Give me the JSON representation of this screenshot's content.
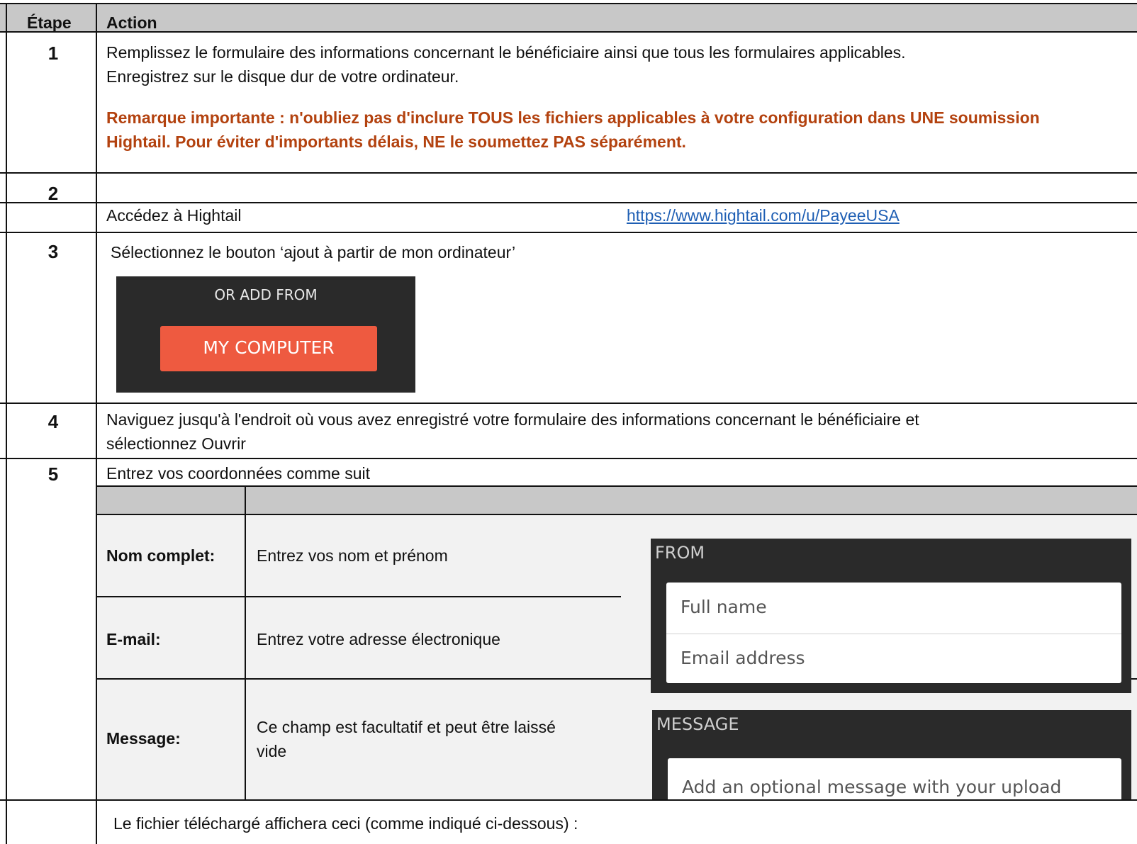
{
  "header": {
    "col_step": "Étape",
    "col_action": "Action"
  },
  "rows": [
    {
      "num": "1",
      "line1": "Remplissez le formulaire des informations concernant le bénéficiaire ainsi que tous les formulaires applicables.",
      "line2": "Enregistrez sur le disque dur de votre ordinateur.",
      "warn1": "Remarque importante : n'oubliez pas d'inclure TOUS les fichiers applicables à votre configuration dans UNE soumission",
      "warn2": "Hightail.  Pour éviter d'importants délais, NE le soumettez PAS séparément."
    },
    {
      "num": "2",
      "text": "Accédez à Hightail",
      "link": "https://www.hightail.com/u/PayeeUSA"
    },
    {
      "num": "3",
      "text": "Sélectionnez le bouton ‘ajout à partir de mon ordinateur’"
    },
    {
      "num": "4",
      "line1": "Naviguez jusqu'à l'endroit où vous avez enregistré votre formulaire des informations concernant le bénéficiaire et",
      "line2": "sélectionnez Ouvrir"
    },
    {
      "num": "5",
      "text": "Entrez vos coordonnées comme suit"
    },
    {
      "num": "",
      "text": "Le fichier téléchargé affichera ceci (comme indiqué ci-dessous) :"
    }
  ],
  "upload_widget": {
    "label": "OR ADD FROM",
    "button": "MY COMPUTER"
  },
  "fields_table": [
    {
      "label": "Nom complet:",
      "desc": "Entrez vos nom et prénom"
    },
    {
      "label": "E-mail:",
      "desc": "Entrez votre adresse électronique"
    },
    {
      "label": "Message:",
      "desc_line1": "Ce champ est facultatif et peut être laissé",
      "desc_line2": "vide"
    }
  ],
  "from_panel": {
    "title": "FROM",
    "name_placeholder": "Full name",
    "email_placeholder": "Email address"
  },
  "message_panel": {
    "title": "MESSAGE",
    "placeholder": "Add an optional message with your upload"
  },
  "colors": {
    "header_bg": "#c8c8c8",
    "warn": "#b3420f",
    "link": "#1f5fb4",
    "button": "#ee5a40",
    "panel": "#2a2a2a",
    "inner_row": "#f2f2f2"
  }
}
